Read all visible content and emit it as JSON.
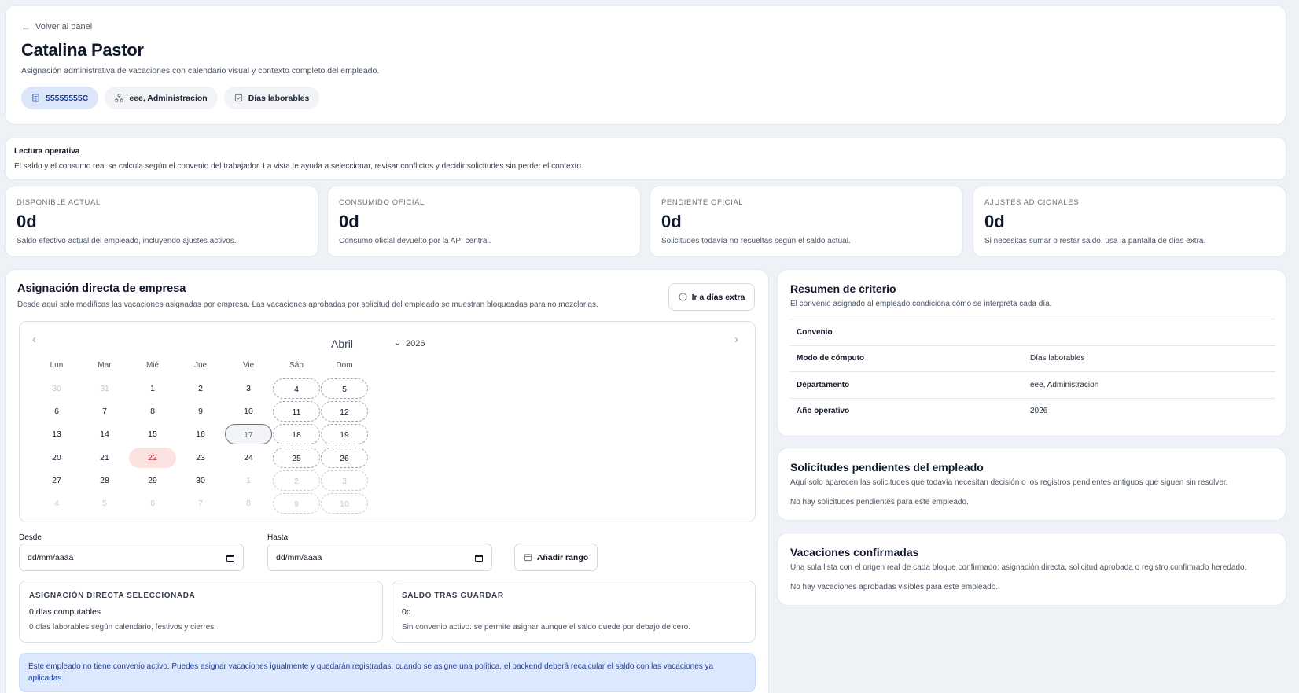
{
  "header": {
    "back_label": "Volver al panel",
    "name": "Catalina Pastor",
    "subtitle": "Asignación administrativa de vacaciones con calendario visual y contexto completo del empleado.",
    "chips": [
      {
        "label": "55555555C",
        "icon": "id-card-icon"
      },
      {
        "label": "eee, Administracion",
        "icon": "org-chart-icon"
      },
      {
        "label": "Días laborables",
        "icon": "checkbox-calendar-icon"
      }
    ]
  },
  "lectura": {
    "title": "Lectura operativa",
    "text": "El saldo y el consumo real se calcula según el convenio del trabajador. La vista te ayuda a seleccionar, revisar conflictos y decidir solicitudes sin perder el contexto."
  },
  "metrics": [
    {
      "label": "Disponible actual",
      "value": "0d",
      "desc": "Saldo efectivo actual del empleado, incluyendo ajustes activos."
    },
    {
      "label": "Consumido oficial",
      "value": "0d",
      "desc": "Consumo oficial devuelto por la API central."
    },
    {
      "label": "Pendiente oficial",
      "value": "0d",
      "desc": "Solicitudes todavía no resueltas según el saldo actual."
    },
    {
      "label": "Ajustes adicionales",
      "value": "0d",
      "desc": "Si necesitas sumar o restar saldo, usa la pantalla de días extra."
    }
  ],
  "assign": {
    "title": "Asignación directa de empresa",
    "subtitle": "Desde aquí solo modificas las vacaciones asignadas por empresa. Las vacaciones aprobadas por solicitud del empleado se muestran bloqueadas para no mezclarlas.",
    "extra_button": "Ir a días extra",
    "calendar": {
      "prev": "‹",
      "next": "›",
      "month": "Abril",
      "year": "2026",
      "weekdays": [
        "Lun",
        "Mar",
        "Mié",
        "Jue",
        "Vie",
        "Sáb",
        "Dom"
      ],
      "weeks": [
        [
          "30",
          "31",
          "1",
          "2",
          "3",
          "4",
          "5"
        ],
        [
          "6",
          "7",
          "8",
          "9",
          "10",
          "11",
          "12"
        ],
        [
          "13",
          "14",
          "15",
          "16",
          "17",
          "18",
          "19"
        ],
        [
          "20",
          "21",
          "22",
          "23",
          "24",
          "25",
          "26"
        ],
        [
          "27",
          "28",
          "29",
          "30",
          "1",
          "2",
          "3"
        ],
        [
          "4",
          "5",
          "6",
          "7",
          "8",
          "9",
          "10"
        ]
      ],
      "today": "17",
      "holiday": "22"
    },
    "from_label": "Desde",
    "to_label": "Hasta",
    "from_value": "dd/mm/aaaa",
    "to_value": "dd/mm/aaaa",
    "range_button": "Añadir rango",
    "selected_box": {
      "title": "Asignación directa seleccionada",
      "value": "0 días computables",
      "desc": "0 días laborables según calendario, festivos y cierres."
    },
    "balance_box": {
      "title": "Saldo tras guardar",
      "value": "0d",
      "desc": "Sin convenio activo: se permite asignar aunque el saldo quede por debajo de cero."
    },
    "notice": "Este empleado no tiene convenio activo. Puedes asignar vacaciones igualmente y quedarán registradas; cuando se asigne una política, el backend deberá recalcular el saldo con las vacaciones ya aplicadas."
  },
  "criterio": {
    "title": "Resumen de criterio",
    "subtitle": "El convenio asignado al empleado condiciona cómo se interpreta cada día.",
    "rows": [
      {
        "key": "Convenio",
        "value": ""
      },
      {
        "key": "Modo de cómputo",
        "value": "Días laborables"
      },
      {
        "key": "Departamento",
        "value": "eee, Administracion"
      },
      {
        "key": "Año operativo",
        "value": "2026"
      }
    ]
  },
  "pendientes": {
    "title": "Solicitudes pendientes del empleado",
    "subtitle": "Aquí solo aparecen las solicitudes que todavía necesitan decisión o los registros pendientes antiguos que siguen sin resolver.",
    "empty": "No hay solicitudes pendientes para este empleado."
  },
  "confirmadas": {
    "title": "Vacaciones confirmadas",
    "subtitle": "Una sola lista con el origen real de cada bloque confirmado: asignación directa, solicitud aprobada o registro confirmado heredado.",
    "empty": "No hay vacaciones aprobadas visibles para este empleado."
  },
  "colors": {
    "accent_chip": "#dbe6fb",
    "holiday_bg": "#fde2e2",
    "holiday_text": "#c0262d",
    "notice_bg": "#dbe8fd",
    "notice_text": "#1d3f9a"
  }
}
